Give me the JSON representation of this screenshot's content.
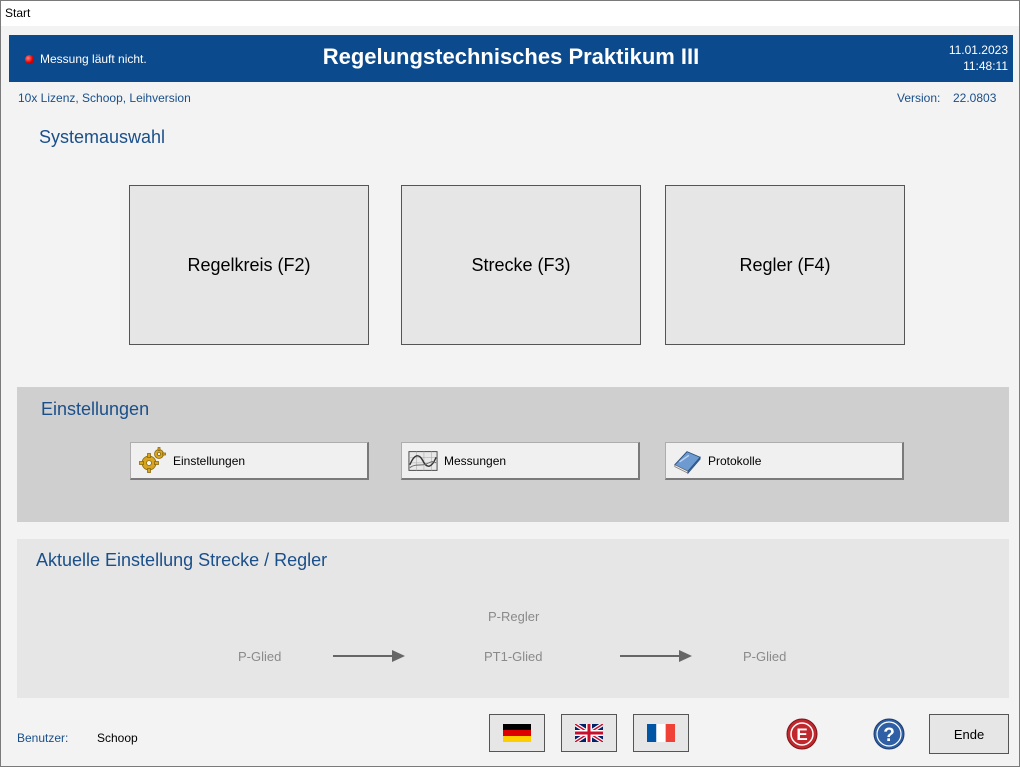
{
  "window": {
    "title": "Start"
  },
  "header": {
    "status_text": "Messung läuft nicht.",
    "app_title": "Regelungstechnisches Praktikum III",
    "date": "11.01.2023",
    "time": "11:48:11",
    "background_color": "#0b4a8c",
    "status_led_color": "#e00000"
  },
  "info": {
    "license": "10x Lizenz, Schoop, Leihversion",
    "version_label": "Version:",
    "version_value": "22.0803"
  },
  "system_selection": {
    "title": "Systemauswahl",
    "buttons": [
      {
        "label": "Regelkreis (F2)"
      },
      {
        "label": "Strecke (F3)"
      },
      {
        "label": "Regler (F4)"
      }
    ]
  },
  "settings": {
    "title": "Einstellungen",
    "buttons": [
      {
        "label": "Einstellungen",
        "icon": "gear-icon"
      },
      {
        "label": "Messungen",
        "icon": "measurement-chart-icon"
      },
      {
        "label": "Protokolle",
        "icon": "book-icon"
      }
    ]
  },
  "current": {
    "title": "Aktuelle Einstellung Strecke / Regler",
    "controller": "P-Regler",
    "input_block": "P-Glied",
    "plant_block": "PT1-Glied",
    "output_block": "P-Glied"
  },
  "footer": {
    "user_label": "Benutzer:",
    "user_value": "Schoop",
    "languages": [
      "german-flag-icon",
      "uk-flag-icon",
      "french-flag-icon"
    ],
    "end_label": "Ende",
    "e_icon": "E",
    "help_icon": "?"
  }
}
